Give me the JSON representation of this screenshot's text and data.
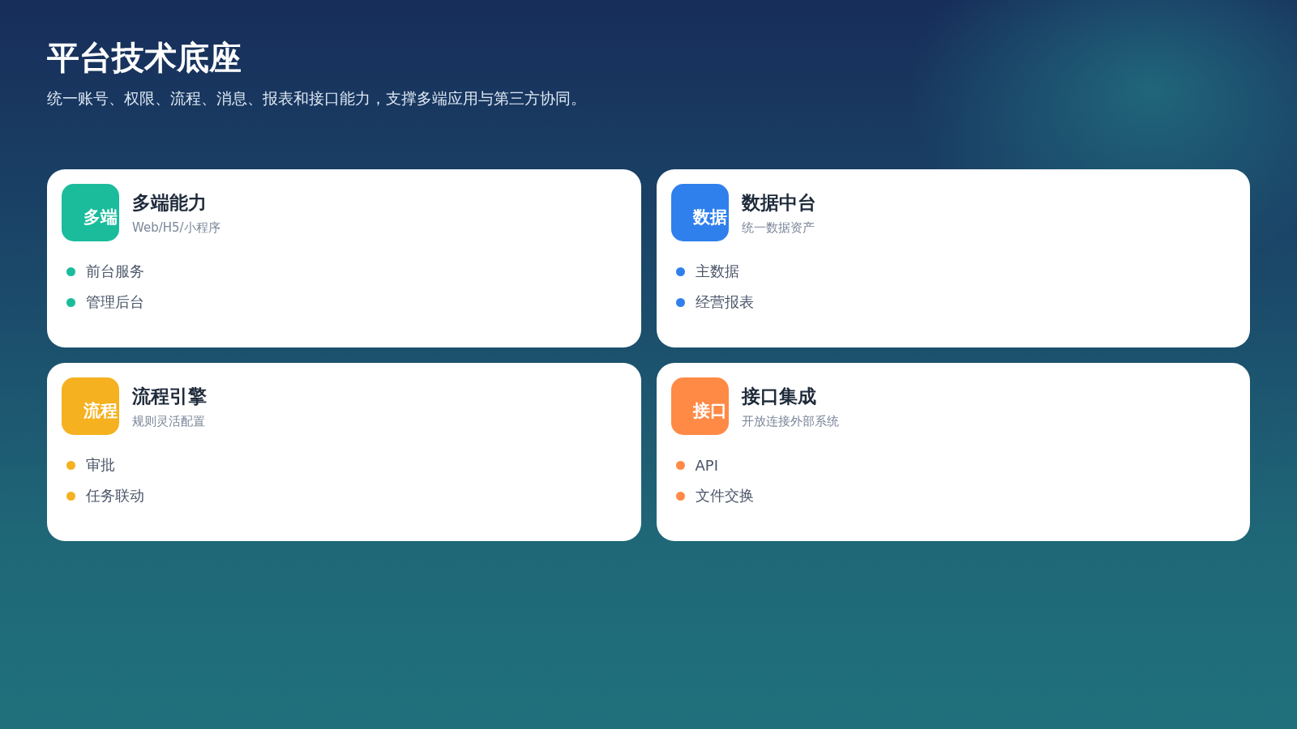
{
  "header": {
    "title": "平台技术底座",
    "subtitle": "统一账号、权限、流程、消息、报表和接口能力，支撑多端应用与第三方协同。"
  },
  "cards": [
    {
      "badge": "多端",
      "title": "多端能力",
      "subtitle": "Web/H5/小程序",
      "color": "#1abc9c",
      "items": [
        "前台服务",
        "管理后台"
      ]
    },
    {
      "badge": "数据",
      "title": "数据中台",
      "subtitle": "统一数据资产",
      "color": "#2f80ed",
      "items": [
        "主数据",
        "经营报表"
      ]
    },
    {
      "badge": "流程",
      "title": "流程引擎",
      "subtitle": "规则灵活配置",
      "color": "#f5b120",
      "items": [
        "审批",
        "任务联动"
      ]
    },
    {
      "badge": "接口",
      "title": "接口集成",
      "subtitle": "开放连接外部系统",
      "color": "#ff8a45",
      "items": [
        "API",
        "文件交换"
      ]
    }
  ]
}
